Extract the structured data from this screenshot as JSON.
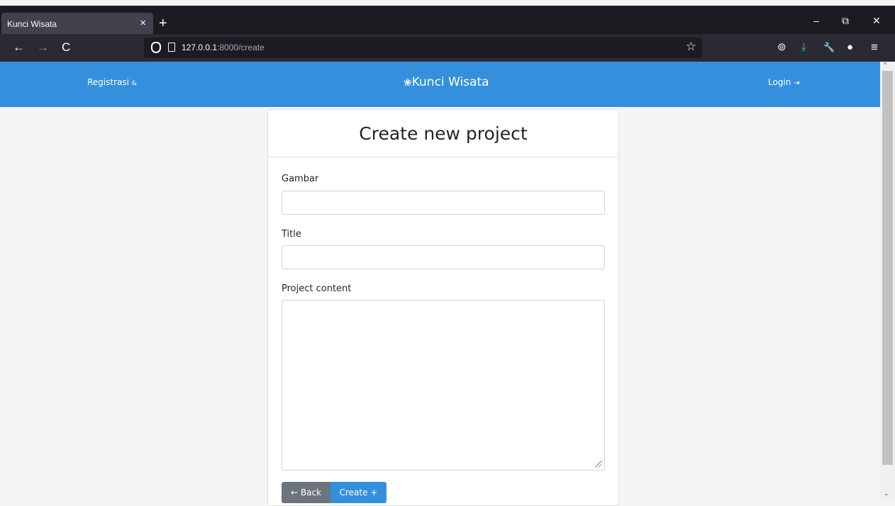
{
  "browser": {
    "tab_title": "Kunci Wisata",
    "tab_close": "×",
    "new_tab": "+",
    "url_host": "127.0.0.1",
    "url_rest": ":8000/create",
    "back_glyph": "←",
    "forward_glyph": "→",
    "reload_glyph": "C",
    "star_glyph": "☆",
    "minimize_glyph": "–",
    "restore_glyph": "⧉",
    "close_glyph": "✕",
    "pocket_glyph": "⊚",
    "download_glyph": "⤓",
    "wrench_glyph": "🔧",
    "profile_glyph": "●",
    "menu_glyph": "≡",
    "download_color": "#33b7f5"
  },
  "header": {
    "register_label": "Registrasi",
    "register_icon": "&",
    "brand_icon": "❀",
    "brand": "Kunci Wisata",
    "login_label": "Login",
    "login_icon": "⇥",
    "bg_color": "#3490dc"
  },
  "form": {
    "title": "Create new project",
    "image_label": "Gambar",
    "image_value": "",
    "title_label": "Title",
    "title_value": "",
    "content_label": "Project content",
    "content_value": "",
    "back_button": "← Back",
    "create_button": "Create +"
  },
  "scrollbar": {
    "up_glyph": "^",
    "down_glyph": "⌄"
  }
}
